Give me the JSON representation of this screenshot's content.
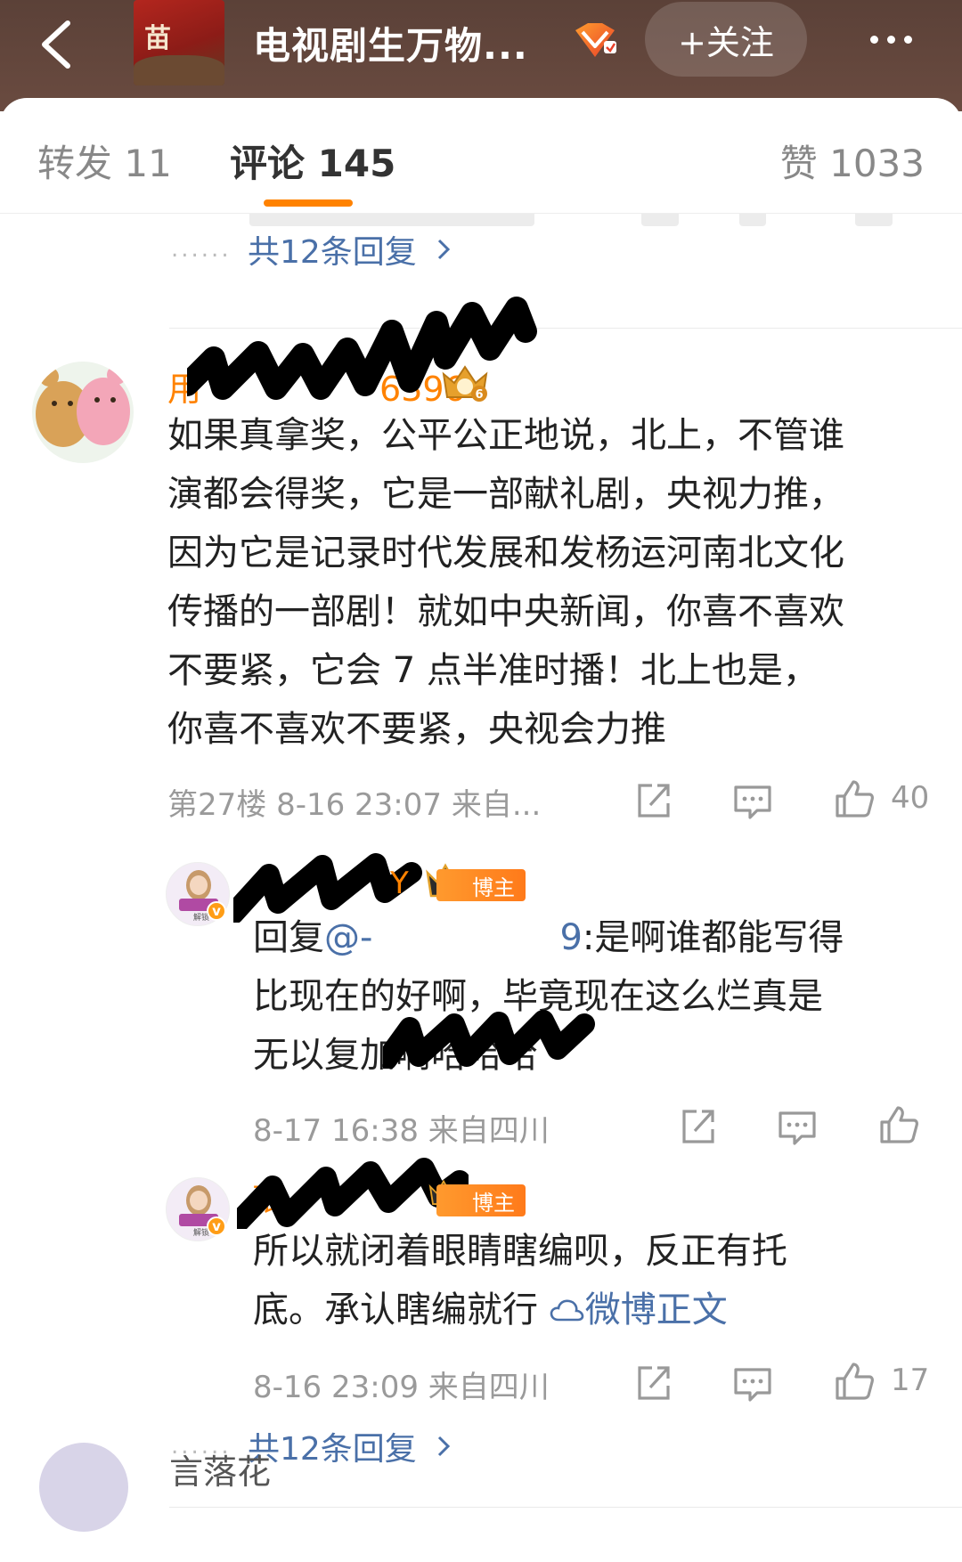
{
  "header": {
    "title": "电视剧生万物...",
    "thumb_text": "苗",
    "follow_label": "+关注"
  },
  "tabs": {
    "repost": "转发 11",
    "comments": "评论 145",
    "likes": "赞 1033"
  },
  "top_more_replies": "共12条回复",
  "comment": {
    "username_prefix": "用",
    "username_suffix": "6396",
    "level_badge": "6",
    "lines": [
      "如果真拿奖，公平公正地说，北上，不管谁",
      "演都会得奖，它是一部献礼剧，央视力推，",
      "因为它是记录时代发展和发杨运河南北文化",
      "传播的一部剧！就如中央新闻，你喜不喜欢",
      "不要紧，它会 7 点半准时播！北上也是，",
      "你喜不喜欢不要紧，央视会力推"
    ],
    "meta": "第27楼 8-16 23:07 来自...",
    "likes": "40"
  },
  "reply1": {
    "name_tail": "Y",
    "tag": "博主",
    "avatar_label": "解锁",
    "reply_prefix": "回复",
    "mention_prefix": "@-",
    "mention_suffix": "9",
    "line1_rest": ":是啊谁都能写得",
    "line2": "比现在的好啊，毕竟现在这么烂真是",
    "line3": "无以复加啊哈哈哈",
    "meta": "8-17 16:38 来自四川"
  },
  "reply2": {
    "name_prefix": "张",
    "tag": "博主",
    "avatar_label": "解锁",
    "line1": "所以就闭着眼睛瞎编呗，反正有托",
    "line2": "底。承认瞎编就行",
    "link": "微博正文",
    "meta": "8-16 23:09 来自四川",
    "likes": "17"
  },
  "bottom_more_replies": "共12条回复",
  "next_comment": {
    "name": "言落花"
  },
  "colors": {
    "accent": "#ff8200",
    "link": "#4a70a8",
    "header_bg": "#5e4339"
  }
}
